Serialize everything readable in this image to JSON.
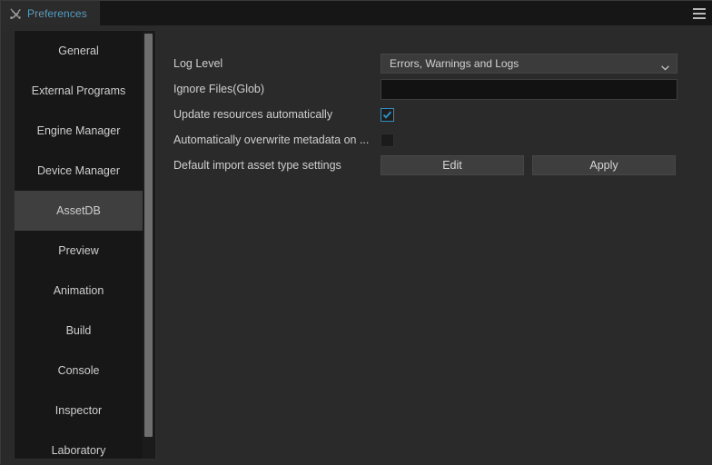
{
  "window": {
    "tab": {
      "label": "Preferences",
      "icon": "tools-icon"
    },
    "menu_icon": "hamburger-menu-icon"
  },
  "sidebar": {
    "items": [
      {
        "label": "General",
        "selected": false
      },
      {
        "label": "External Programs",
        "selected": false
      },
      {
        "label": "Engine Manager",
        "selected": false
      },
      {
        "label": "Device Manager",
        "selected": false
      },
      {
        "label": "AssetDB",
        "selected": true
      },
      {
        "label": "Preview",
        "selected": false
      },
      {
        "label": "Animation",
        "selected": false
      },
      {
        "label": "Build",
        "selected": false
      },
      {
        "label": "Console",
        "selected": false
      },
      {
        "label": "Inspector",
        "selected": false
      },
      {
        "label": "Laboratory",
        "selected": false
      }
    ]
  },
  "form": {
    "log_level": {
      "label": "Log Level",
      "value": "Errors, Warnings and Logs",
      "chevron_icon": "chevron-down-icon"
    },
    "ignore_files": {
      "label": "Ignore Files(Glob)",
      "value": "",
      "placeholder": ""
    },
    "update_resources": {
      "label": "Update resources automatically",
      "checked": true,
      "check_icon": "checkmark-icon"
    },
    "overwrite_metadata": {
      "label": "Automatically overwrite metadata on ...",
      "checked": false
    },
    "default_import": {
      "label": "Default import asset type settings",
      "edit_label": "Edit",
      "apply_label": "Apply"
    }
  },
  "colors": {
    "accent": "#2e8fc0",
    "tab_text": "#5b9cbd",
    "panel_bg": "#2a2a2a",
    "list_bg": "#171717",
    "selected_bg": "#3f3f3f"
  }
}
